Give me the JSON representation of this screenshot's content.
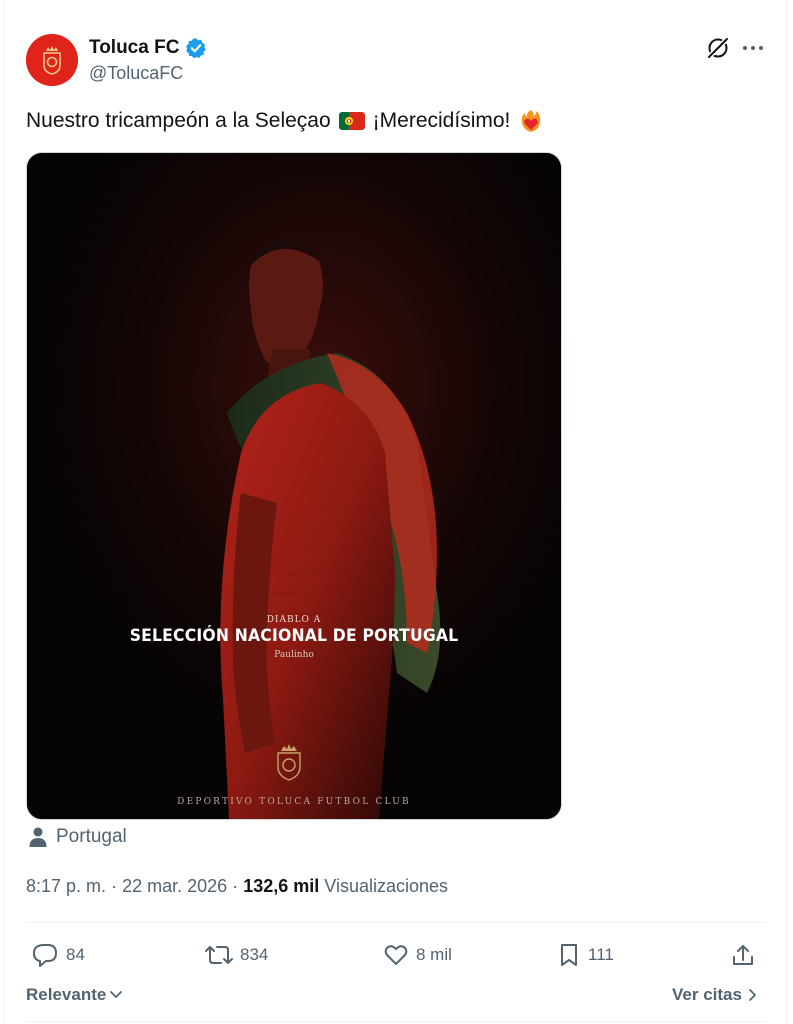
{
  "account": {
    "name": "Toluca FC",
    "handle": "@TolucaFC",
    "verified": true
  },
  "tweet": {
    "text_before_flag": "Nuestro tricampeón a la Seleçao",
    "text_after_flag": "¡Merecidísimo!",
    "emoji": [
      "portugal-flag",
      "red-heart-fire"
    ]
  },
  "media": {
    "kicker": "DIABLO A",
    "title": "SELECCIÓN NACIONAL DE PORTUGAL",
    "player": "Paulinho",
    "footer": "DEPORTIVO TOLUCA FUTBOL CLUB"
  },
  "location": {
    "label": "Portugal",
    "icon": "person-icon"
  },
  "meta": {
    "time": "8:17 p. m.",
    "separator": "·",
    "date": "22 mar. 2026",
    "views_count": "132,6 mil",
    "views_label": "Visualizaciones"
  },
  "actions": {
    "replies": "84",
    "reposts": "834",
    "likes": "8 mil",
    "bookmarks": "111"
  },
  "footer": {
    "sort_label": "Relevante",
    "quotes_label": "Ver citas"
  },
  "colors": {
    "text_primary": "#0f1419",
    "text_secondary": "#536471",
    "verified_blue": "#1d9bf0",
    "brand_red": "#e0241b"
  }
}
